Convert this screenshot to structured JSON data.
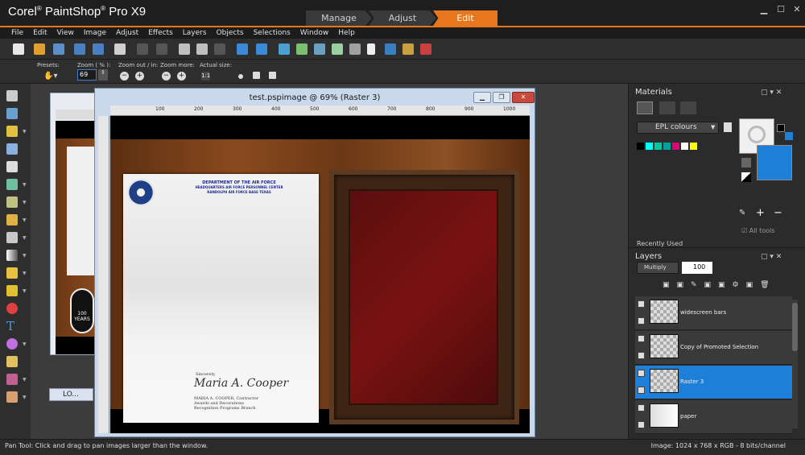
{
  "app": {
    "title": "Corel",
    "title_product": "PaintShop",
    "title_rest": "Pro X9"
  },
  "workspace_tabs": [
    {
      "label": "Manage"
    },
    {
      "label": "Adjust"
    },
    {
      "label": "Edit",
      "active": true
    }
  ],
  "menu": [
    "File",
    "Edit",
    "View",
    "Image",
    "Adjust",
    "Effects",
    "Layers",
    "Objects",
    "Selections",
    "Window",
    "Help"
  ],
  "options": {
    "presets_label": "Presets:",
    "zoom_label": "Zoom ( % ):",
    "zoom_value": "69",
    "zoom_out_in_label": "Zoom out / in:",
    "zoom_more_label": "Zoom more:",
    "actual_size_label": "Actual size:"
  },
  "document": {
    "title": "test.pspimage @  69% (Raster 3)",
    "minimized_label": "LO...",
    "letterhead": {
      "org": "DEPARTMENT OF THE AIR FORCE",
      "line2": "HEADQUARTERS AIR FORCE PERSONNEL CENTER",
      "line3": "RANDOLPH AIR FORCE BASE TEXAS"
    },
    "sincerely": "Sincerely,",
    "signature": "Maria A. Cooper",
    "signer_name": "MARIA A. COOPER, Contractor",
    "signer_line2": "Awards and Decorations",
    "signer_line3": "Recognition Programs Branch",
    "back_badge_text": "100 YEARS",
    "ruler_ticks": [
      "100",
      "200",
      "300",
      "400",
      "500",
      "600",
      "700",
      "800",
      "900",
      "1000"
    ]
  },
  "materials": {
    "title": "Materials",
    "palette": "EPL colours",
    "swatches": [
      "#000000",
      "#00ffff",
      "#00c8a0",
      "#00a0a0",
      "#e0007a",
      "#ffffff",
      "#ffff00"
    ],
    "fg_color": "#f0f0f0",
    "bg_color": "#1e7fd8",
    "all_tools_label": "All tools",
    "recently_used_label": "Recently Used"
  },
  "layers": {
    "title": "Layers",
    "blend_mode": "Multiply",
    "opacity": "100",
    "items": [
      {
        "name": "widescreen bars",
        "active": false
      },
      {
        "name": "Copy of Promoted Selection",
        "active": false
      },
      {
        "name": "Raster 3",
        "active": true
      },
      {
        "name": "paper",
        "active": false
      }
    ]
  },
  "status": {
    "left": "Pan Tool: Click and drag to pan images larger than the window.",
    "right": "Image:  1024 x 768 x RGB - 8 bits/channel"
  }
}
